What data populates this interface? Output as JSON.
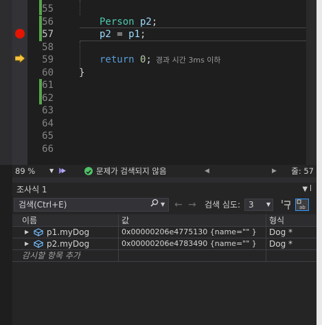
{
  "editor": {
    "lines": [
      {
        "num": "55",
        "code": "..."
      },
      {
        "num": "56",
        "code": "Person p2;"
      },
      {
        "num": "57",
        "code": "p2 = p1;"
      },
      {
        "num": "58",
        "code": ""
      },
      {
        "num": "59",
        "code": "return 0;"
      },
      {
        "num": "60",
        "code": "}"
      },
      {
        "num": "61",
        "code": ""
      },
      {
        "num": "62",
        "code": ""
      },
      {
        "num": "63",
        "code": ""
      },
      {
        "num": "64",
        "code": ""
      },
      {
        "num": "65",
        "code": ""
      },
      {
        "num": "66",
        "code": ""
      }
    ],
    "tokens": {
      "person_type": "Person",
      "p2_decl": " p2",
      "semicolon": ";",
      "p2": "p2",
      "assign": " = ",
      "p1": "p1",
      "return_kw": "return",
      "zero": "0",
      "brace": "}"
    },
    "perf_hint": "경과 시간 3ms 이하"
  },
  "status": {
    "zoom": "89 %",
    "issues_text": "문제가 검색되지 않음",
    "line_indicator": "줄: 57"
  },
  "watch": {
    "title": "조사식 1",
    "search_placeholder": "검색(Ctrl+E)",
    "depth_label": "검색 심도:",
    "depth_value": "3",
    "columns": {
      "name": "이름",
      "value": "값",
      "type": "형식"
    },
    "rows": [
      {
        "name": "p1.myDog",
        "value": "0x00000206e4775130 {name=\"\" }",
        "type": "Dog *"
      },
      {
        "name": "p2.myDog",
        "value": "0x00000206e4783490 {name=\"\" }",
        "type": "Dog *"
      }
    ],
    "add_item": "감시할 항목 추가"
  },
  "colors": {
    "background": "#1e1e1e",
    "panel": "#252526",
    "breakpoint": "#e51400",
    "change_bar": "#57a64a",
    "keyword": "#569cd6",
    "type": "#4ec9b0",
    "variable": "#9cdcfe",
    "number": "#b5cea8"
  },
  "icons": [
    "breakpoint-icon",
    "current-statement-arrow-icon",
    "check-circle-icon",
    "search-icon",
    "pin-icon",
    "object-icon"
  ]
}
